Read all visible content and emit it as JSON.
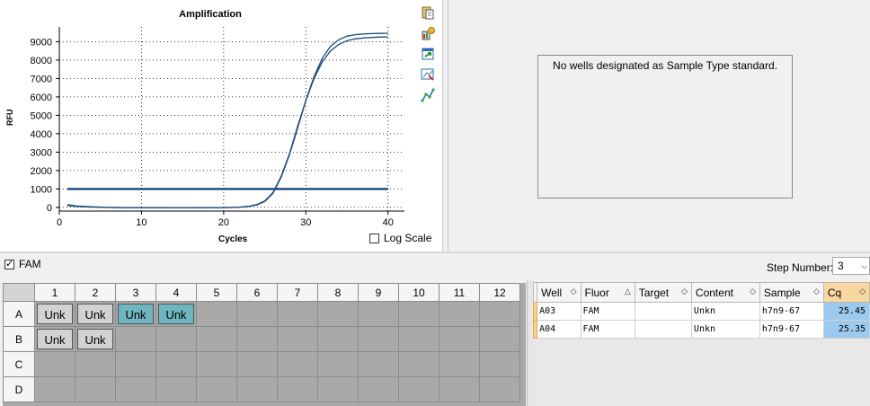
{
  "chart_data": {
    "type": "line",
    "title": "Amplification",
    "xlabel": "Cycles",
    "ylabel": "RFU",
    "xlim": [
      0,
      42
    ],
    "ylim": [
      -200,
      9800
    ],
    "xticks": [
      0,
      10,
      20,
      30,
      40
    ],
    "yticks": [
      0,
      1000,
      2000,
      3000,
      4000,
      5000,
      6000,
      7000,
      8000,
      9000
    ],
    "grid": true,
    "threshold": 1000,
    "series": [
      {
        "x": [
          1,
          2,
          4,
          6,
          8,
          10,
          12,
          14,
          16,
          18,
          20,
          21,
          22,
          23,
          24,
          25,
          26,
          27,
          28,
          29,
          30,
          31,
          32,
          33,
          34,
          35,
          36,
          37,
          38,
          39,
          40
        ],
        "y": [
          150,
          80,
          30,
          0,
          -10,
          -15,
          -20,
          -20,
          -20,
          -15,
          -10,
          0,
          20,
          60,
          150,
          350,
          800,
          1700,
          2900,
          4400,
          5800,
          7000,
          7900,
          8500,
          8850,
          9050,
          9150,
          9200,
          9230,
          9250,
          9260
        ]
      },
      {
        "x": [
          1,
          2,
          4,
          6,
          8,
          10,
          12,
          14,
          16,
          18,
          20,
          21,
          22,
          23,
          24,
          25,
          26,
          27,
          28,
          29,
          30,
          31,
          32,
          33,
          34,
          35,
          36,
          37,
          38,
          39,
          40
        ],
        "y": [
          100,
          60,
          20,
          -5,
          -15,
          -20,
          -25,
          -25,
          -25,
          -20,
          -15,
          -5,
          15,
          50,
          130,
          320,
          760,
          1650,
          2850,
          4300,
          5800,
          7100,
          8100,
          8750,
          9100,
          9300,
          9380,
          9420,
          9440,
          9450,
          9460
        ]
      }
    ],
    "series_color": "#1e4b7a",
    "threshold_color": "#0e3f74"
  },
  "amplification": {
    "title": "Amplification",
    "y_label": "RFU",
    "x_label": "Cycles",
    "log_scale_label": "Log Scale",
    "toolbar_icons": [
      "copy-icon",
      "export-icon",
      "refresh-icon",
      "zoom-icon",
      "graph-settings-icon"
    ]
  },
  "standard_curve": {
    "message": "No wells designated as Sample Type standard."
  },
  "fluor_filter": {
    "label": "FAM",
    "checked": true
  },
  "step_number": {
    "label": "Step Number:",
    "value": "3"
  },
  "plate": {
    "columns": [
      "1",
      "2",
      "3",
      "4",
      "5",
      "6",
      "7",
      "8",
      "9",
      "10",
      "11",
      "12"
    ],
    "rows": [
      "A",
      "B",
      "C",
      "D"
    ],
    "wells": {
      "A1": {
        "label": "Unk",
        "color": "grey"
      },
      "A2": {
        "label": "Unk",
        "color": "grey"
      },
      "A3": {
        "label": "Unk",
        "color": "teal"
      },
      "A4": {
        "label": "Unk",
        "color": "teal"
      },
      "B1": {
        "label": "Unk",
        "color": "grey"
      },
      "B2": {
        "label": "Unk",
        "color": "grey"
      }
    }
  },
  "results": {
    "headers": [
      "Well",
      "Fluor",
      "Target",
      "Content",
      "Sample",
      "Cq"
    ],
    "sort_marks": [
      "◇",
      "△",
      "◇",
      "◇",
      "◇",
      "◇"
    ],
    "rows": [
      [
        "A03",
        "FAM",
        "",
        "Unkn",
        "h7n9-67",
        "25.45"
      ],
      [
        "A04",
        "FAM",
        "",
        "Unkn",
        "h7n9-67",
        "25.35"
      ]
    ]
  }
}
